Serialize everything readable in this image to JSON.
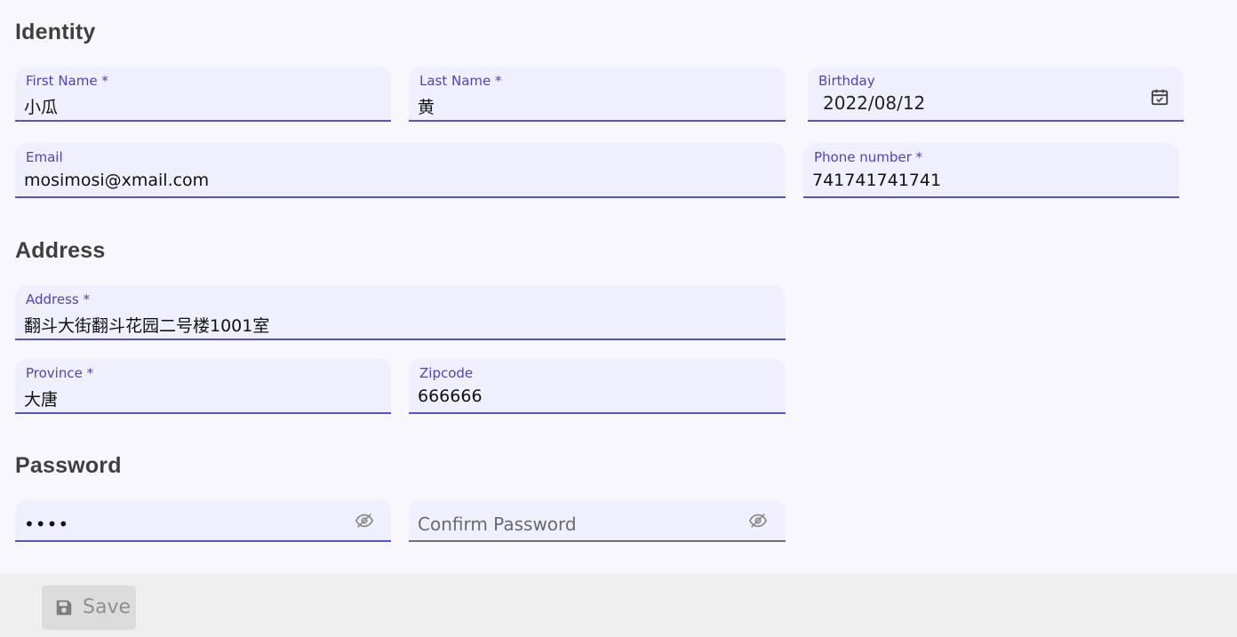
{
  "sections": {
    "identity": "Identity",
    "address": "Address",
    "password": "Password"
  },
  "identity": {
    "first_name": {
      "label": "First Name *",
      "value": "小瓜"
    },
    "last_name": {
      "label": "Last Name *",
      "value": "黄"
    },
    "birthday": {
      "label": "Birthday",
      "value": "2022/08/12",
      "icon": "calendar-icon"
    },
    "email": {
      "label": "Email",
      "value": "mosimosi@xmail.com"
    },
    "phone": {
      "label": "Phone number *",
      "value": "741741741741"
    }
  },
  "address": {
    "address": {
      "label": "Address *",
      "value": "翻斗大街翻斗花园二号楼1001室"
    },
    "province": {
      "label": "Province *",
      "value": "大唐"
    },
    "zipcode": {
      "label": "Zipcode",
      "value": "666666"
    }
  },
  "password": {
    "password": {
      "value": "••••",
      "icon": "eye-off-icon"
    },
    "confirm": {
      "placeholder": "Confirm Password",
      "icon": "eye-off-icon"
    }
  },
  "footer": {
    "save_label": "Save",
    "save_icon": "floppy-disk-icon"
  },
  "colors": {
    "accent": "#5b50d0",
    "label": "#4f44b8",
    "field_bg": "#efeffd",
    "page_bg": "#f8f7fd",
    "footer_bg": "#efefef"
  }
}
